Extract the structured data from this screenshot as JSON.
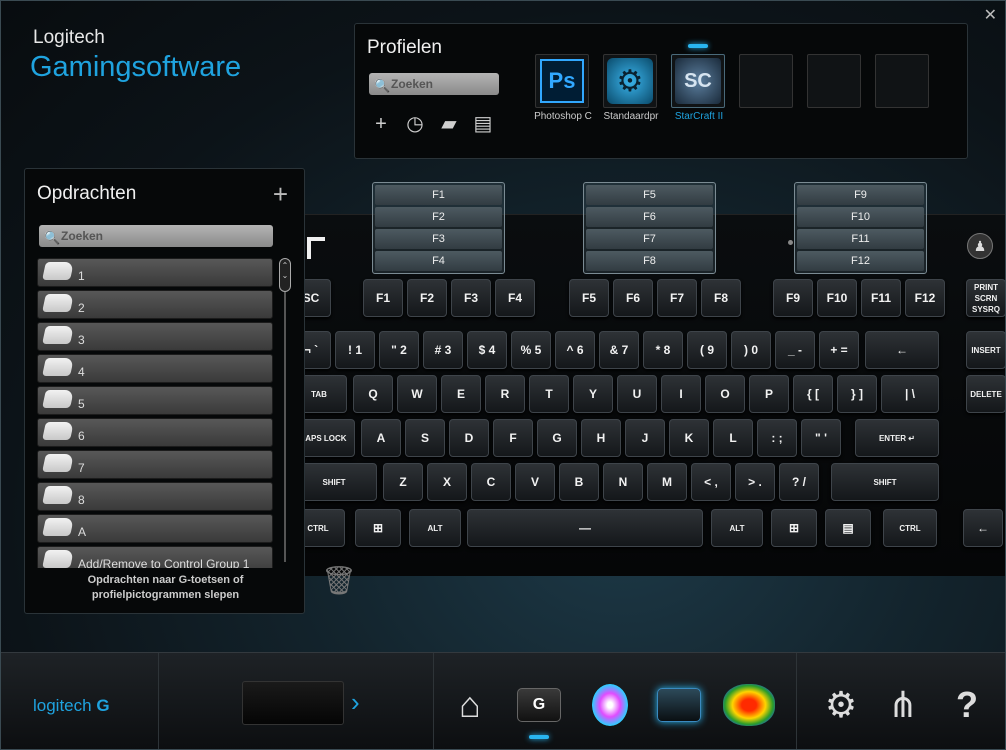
{
  "app": {
    "brand_line1": "Logitech",
    "brand_line2": "Gamingsoftware",
    "close_glyph": "✕"
  },
  "profiles": {
    "title": "Profielen",
    "search_placeholder": "Zoeken",
    "tools": [
      "plus-icon",
      "clock-icon",
      "folder-icon",
      "printer-icon"
    ],
    "tiles": [
      {
        "label": "Photoshop C",
        "icon": "photoshop-icon",
        "glyph": "Ps",
        "active": false
      },
      {
        "label": "Standaardpr",
        "icon": "gear-icon",
        "glyph": "⚙",
        "active": false
      },
      {
        "label": "StarCraft II",
        "icon": "starcraft-icon",
        "glyph": "SC",
        "active": true
      },
      {
        "label": "",
        "icon": "empty-slot",
        "glyph": "",
        "active": false
      },
      {
        "label": "",
        "icon": "empty-slot",
        "glyph": "",
        "active": false
      },
      {
        "label": "",
        "icon": "empty-slot",
        "glyph": "",
        "active": false
      }
    ]
  },
  "commands": {
    "title": "Opdrachten",
    "add_glyph": "+",
    "search_placeholder": "Zoeken",
    "items": [
      "1",
      "2",
      "3",
      "4",
      "5",
      "6",
      "7",
      "8",
      "A",
      "Add/Remove to Control Group 1"
    ],
    "footer_line1": "Opdrachten naar G-toetsen of",
    "footer_line2": "profielpictogrammen slepen"
  },
  "gkey_groups": [
    [
      "F1",
      "F2",
      "F3",
      "F4"
    ],
    [
      "F5",
      "F6",
      "F7",
      "F8"
    ],
    [
      "F9",
      "F10",
      "F11",
      "F12"
    ]
  ],
  "keyboard": {
    "indicators": [
      "indicator-1",
      "indicator-2",
      "indicator-3",
      "indicator-4"
    ],
    "rows": {
      "fn": [
        "SC",
        "F1",
        "F2",
        "F3",
        "F4",
        "F5",
        "F6",
        "F7",
        "F8",
        "F9",
        "F10",
        "F11",
        "F12",
        "PRINT SCRN SYSRQ"
      ],
      "num": [
        "¬ `",
        "! 1",
        "\" 2",
        "# 3",
        "$ 4",
        "% 5",
        "^ 6",
        "& 7",
        "* 8",
        "( 9",
        ") 0",
        "_ -",
        "+ =",
        "←",
        "INSERT"
      ],
      "q": [
        "TAB",
        "Q",
        "W",
        "E",
        "R",
        "T",
        "Y",
        "U",
        "I",
        "O",
        "P",
        "{ [",
        "} ]",
        "| \\",
        "DELETE"
      ],
      "a": [
        "CAPS LOCK",
        "A",
        "S",
        "D",
        "F",
        "G",
        "H",
        "J",
        "K",
        "L",
        ": ;",
        "\" '",
        "ENTER ↵"
      ],
      "z": [
        "SHIFT",
        "Z",
        "X",
        "C",
        "V",
        "B",
        "N",
        "M",
        "< ,",
        "> .",
        "? /",
        "SHIFT"
      ],
      "ctrl": [
        "CTRL",
        "⊞",
        "ALT",
        "—",
        "ALT",
        "⊞",
        "▤",
        "CTRL",
        "←"
      ]
    }
  },
  "bottom": {
    "logo_text": "logitech",
    "nav_icons": [
      "home-icon",
      "gkey-icon",
      "lighting-icon",
      "backlight-icon",
      "heatmap-icon",
      "settings-icon",
      "share-icon",
      "help-icon"
    ]
  }
}
